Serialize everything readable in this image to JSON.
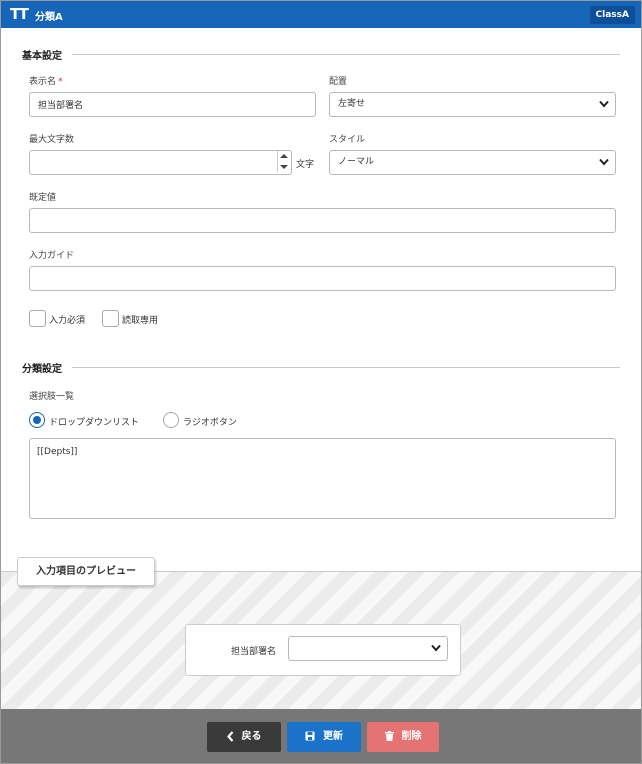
{
  "window": {
    "app_icon": "TT",
    "title": "分類A",
    "badge": "ClassA"
  },
  "basic_settings": {
    "section_title": "基本設定",
    "display_name": {
      "label": "表示名",
      "required_mark": "*",
      "value": "担当部署名"
    },
    "alignment": {
      "label": "配置",
      "value": "左寄せ"
    },
    "max_chars": {
      "label": "最大文字数",
      "value": "",
      "unit": "文字"
    },
    "style": {
      "label": "スタイル",
      "value": "ノーマル"
    },
    "default_value": {
      "label": "既定値",
      "value": ""
    },
    "input_guide": {
      "label": "入力ガイド",
      "value": ""
    },
    "required_checkbox": {
      "label": "入力必須",
      "checked": false
    },
    "readonly_checkbox": {
      "label": "読取専用",
      "checked": false
    }
  },
  "classification_settings": {
    "section_title": "分類設定",
    "options_label": "選択肢一覧",
    "radio_dropdown": {
      "label": "ドロップダウンリスト",
      "selected": true
    },
    "radio_radio": {
      "label": "ラジオボタン",
      "selected": false
    },
    "options_text": "[[Depts]]"
  },
  "preview": {
    "tab_label": "入力項目のプレビュー",
    "field_label": "担当部署名",
    "field_value": ""
  },
  "footer": {
    "back_label": "戻る",
    "update_label": "更新",
    "delete_label": "削除"
  },
  "colors": {
    "accent": "#1565b8",
    "back_button": "#3a3a3a",
    "update_button": "#1a73c8",
    "delete_button": "#e57373",
    "footer_bg": "#777777"
  }
}
